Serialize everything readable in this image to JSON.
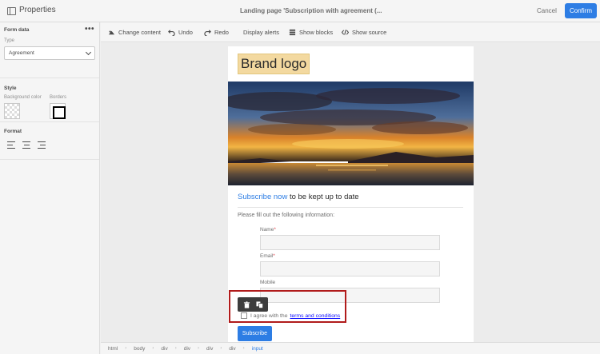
{
  "header": {
    "panel_title": "Properties",
    "document_title": "Landing page 'Subscription with agreement (...",
    "cancel_label": "Cancel",
    "confirm_label": "Confirm"
  },
  "left_panel": {
    "form_data": {
      "title": "Form data",
      "type_label": "Type",
      "type_value": "Agreement"
    },
    "style": {
      "title": "Style",
      "background_label": "Background color",
      "borders_label": "Borders"
    },
    "format": {
      "title": "Format"
    }
  },
  "toolbar": {
    "change_content": "Change content",
    "undo": "Undo",
    "redo": "Redo",
    "display_alerts": "Display alerts",
    "show_blocks": "Show blocks",
    "show_source": "Show source"
  },
  "page": {
    "brand_logo": "Brand logo",
    "headline_link": "Subscribe now",
    "headline_rest": " to be kept up to date",
    "intro": "Please fill out the following information:",
    "fields": [
      {
        "label": "Name",
        "required": "*"
      },
      {
        "label": "Email",
        "required": "*"
      },
      {
        "label": "Mobile",
        "required": ""
      }
    ],
    "agree_text": "I agree with the",
    "terms_link": "terms and conditions",
    "subscribe_label": "Subscribe"
  },
  "breadcrumb": [
    "html",
    "body",
    "div",
    "div",
    "div",
    "div",
    "input"
  ],
  "colors": {
    "accent": "#2d7de4",
    "selection_outline": "#b11b1b",
    "logo_highlight": "#f3d9a0"
  }
}
